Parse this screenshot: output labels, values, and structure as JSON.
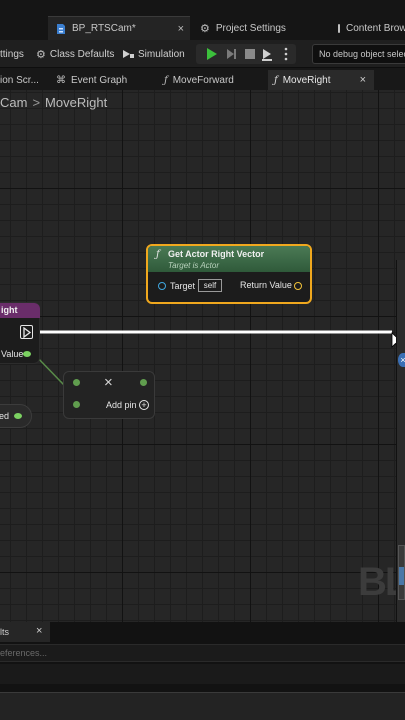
{
  "doc_tabs": {
    "active_tab": "BP_RTSCam*",
    "project_settings": "Project Settings",
    "content_browser": "Content Brow"
  },
  "toolbar": {
    "settings": "ttings",
    "class_defaults": "Class Defaults",
    "simulation": "Simulation",
    "debug_filter": "No debug object select"
  },
  "graph_tabs": {
    "construction_script": "ion Scr...",
    "event_graph": "Event Graph",
    "move_forward": "MoveForward",
    "move_right": "MoveRight"
  },
  "breadcrumb": {
    "parent": "Cam",
    "separator": ">",
    "current": "MoveRight"
  },
  "nodes": {
    "get_actor_right_vector": {
      "title": "Get Actor Right Vector",
      "subtitle": "Target is Actor",
      "target_label": "Target",
      "target_value": "self",
      "return_label": "Return Value",
      "function_icon": "ƒ"
    },
    "move_right_event": {
      "title": "ight",
      "axis_value_label": "Value"
    },
    "make_array": {
      "add_pin_label": "Add pin",
      "close_symbol": "×"
    },
    "partial_node": {
      "label": "ed"
    }
  },
  "watermark": "BL",
  "bottom_panel": {
    "tab_label": "lts",
    "close_symbol": "×",
    "search_placeholder": "eferences..."
  },
  "colors": {
    "function_node_header": "#3a6b45",
    "selection_outline": "#f0a81e",
    "exec_wire": "#ffffff",
    "event_node_header": "#6a2d6a",
    "float_pin": "#7bd161",
    "vector_pin": "#f3c33a",
    "object_pin": "#3fa7e0"
  }
}
